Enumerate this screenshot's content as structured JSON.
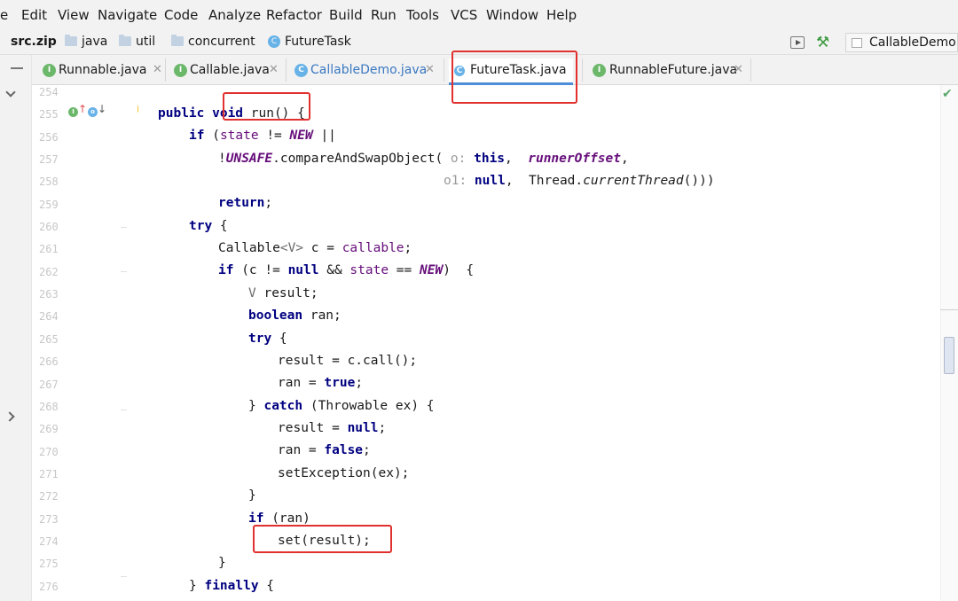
{
  "menu": [
    "e",
    "Edit",
    "View",
    "Navigate",
    "Code",
    "Analyze",
    "Refactor",
    "Build",
    "Run",
    "Tools",
    "VCS",
    "Window",
    "Help"
  ],
  "breadcrumb": [
    "src.zip",
    "java",
    "util",
    "concurrent",
    "FutureTask"
  ],
  "run_config": "CallableDemo",
  "tabs": [
    {
      "label": "Runnable.java",
      "icon": "interface-icon",
      "icon_letter": "I"
    },
    {
      "label": "Callable.java",
      "icon": "interface-icon",
      "icon_letter": "I"
    },
    {
      "label": "CallableDemo.java",
      "icon": "class-icon",
      "icon_letter": "C"
    },
    {
      "label": "FutureTask.java",
      "icon": "class-icon",
      "icon_letter": "C"
    },
    {
      "label": "RunnableFuture.java",
      "icon": "interface-icon",
      "icon_letter": "I"
    }
  ],
  "gutter_badges": {
    "implements": "I",
    "override": "o"
  },
  "lines": [
    {
      "n": "254"
    },
    {
      "n": "255"
    },
    {
      "n": "256"
    },
    {
      "n": "257"
    },
    {
      "n": "258"
    },
    {
      "n": "259"
    },
    {
      "n": "260"
    },
    {
      "n": "261"
    },
    {
      "n": "262"
    },
    {
      "n": "263"
    },
    {
      "n": "264"
    },
    {
      "n": "265"
    },
    {
      "n": "266"
    },
    {
      "n": "267"
    },
    {
      "n": "268"
    },
    {
      "n": "269"
    },
    {
      "n": "270"
    },
    {
      "n": "271"
    },
    {
      "n": "272"
    },
    {
      "n": "273"
    },
    {
      "n": "274"
    },
    {
      "n": "275"
    },
    {
      "n": "276"
    }
  ],
  "code": {
    "l255": {
      "a": "public ",
      "b": "void",
      "c": " run() {"
    },
    "l256": {
      "a": "if",
      "b": " (",
      "c": "state",
      "d": " != ",
      "e": "NEW",
      "f": " ||"
    },
    "l257": {
      "a": "!",
      "b": "UNSAFE",
      "c": ".compareAndSwapObject(",
      "d": " o: ",
      "e": "this",
      "f": ",  ",
      "g": "runnerOffset",
      "h": ","
    },
    "l258": {
      "a": "o1: ",
      "b": "null",
      "c": ",  Thread.",
      "d": "currentThread",
      "e": "()))"
    },
    "l259": {
      "a": "return",
      "b": ";"
    },
    "l260": {
      "a": "try",
      "b": " {"
    },
    "l261": {
      "a": "Callable",
      "b": "<V>",
      "c": " c = ",
      "d": "callable",
      "e": ";"
    },
    "l262": {
      "a": "if",
      "b": " (c != ",
      "c": "null",
      "d": " && ",
      "e": "state",
      "f": " == ",
      "g": "NEW",
      "h": ")  {"
    },
    "l263": {
      "a": "V",
      "b": " result;"
    },
    "l264": {
      "a": "boolean",
      "b": " ran;"
    },
    "l265": {
      "a": "try",
      "b": " {"
    },
    "l266": {
      "a": "result = c.call();"
    },
    "l267": {
      "a": "ran = ",
      "b": "true",
      "c": ";"
    },
    "l268": {
      "a": "} ",
      "b": "catch",
      "c": " (Throwable ex) {"
    },
    "l269": {
      "a": "result = ",
      "b": "null",
      "c": ";"
    },
    "l270": {
      "a": "ran = ",
      "b": "false",
      "c": ";"
    },
    "l271": {
      "a": "setException(ex);"
    },
    "l272": {
      "a": "}"
    },
    "l273": {
      "a": "if",
      "b": " (ran)"
    },
    "l274": {
      "a": "set(result);"
    },
    "l275": {
      "a": "}"
    },
    "l276": {
      "a": "} ",
      "b": "finally",
      "c": " {"
    }
  },
  "colors": {
    "keyword": "#000080",
    "field": "#660e7a",
    "annotation": "#e0312f",
    "active_tab_underline": "#4c8ed9"
  }
}
